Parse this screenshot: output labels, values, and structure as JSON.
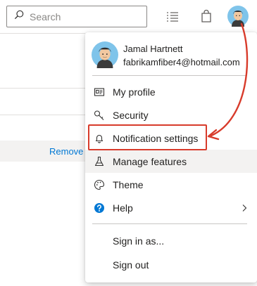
{
  "header": {
    "search": {
      "placeholder": "Search",
      "value": ""
    },
    "icons": [
      "search-icon",
      "task-list-icon",
      "shopping-bag-icon",
      "user-avatar-icon"
    ]
  },
  "background": {
    "remove_link": "Remove"
  },
  "menu": {
    "user": {
      "name": "Jamal Hartnett",
      "email": "fabrikamfiber4@hotmail.com"
    },
    "items": [
      {
        "label": "My profile",
        "icon": "id-card-icon"
      },
      {
        "label": "Security",
        "icon": "key-icon"
      },
      {
        "label": "Notification settings",
        "icon": "bell-icon",
        "highlighted": true
      },
      {
        "label": "Manage features",
        "icon": "flask-icon",
        "hovered": true
      },
      {
        "label": "Theme",
        "icon": "palette-icon"
      },
      {
        "label": "Help",
        "icon": "help-icon",
        "has_submenu": true
      }
    ],
    "footer_items": [
      {
        "label": "Sign in as..."
      },
      {
        "label": "Sign out"
      }
    ]
  },
  "colors": {
    "accent": "#0078d4",
    "callout": "#d83b2b",
    "hover_bg": "#f3f2f1"
  }
}
